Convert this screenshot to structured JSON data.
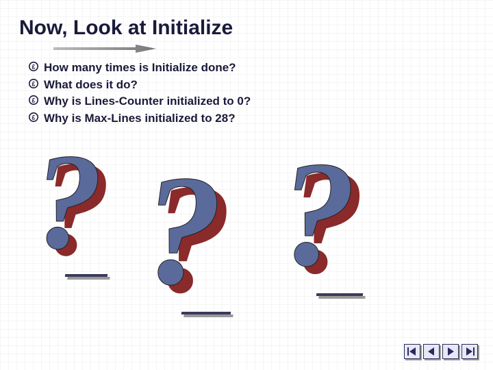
{
  "title": "Now, Look at Initialize",
  "bullets": [
    "How many times is Initialize done?",
    "What does it do?",
    "Why is Lines-Counter initialized to 0?",
    "Why is Max-Lines initialized to 28?"
  ],
  "qmark_glyph": "?",
  "colors": {
    "heading": "#1a1a3a",
    "bullet_text": "#1a1a3a",
    "qmark_fill": "#5a6a9a",
    "qmark_shadow": "#8a2a2a",
    "nav_border": "#2a2a60",
    "nav_bg": "#e8e8f4",
    "nav_arrow": "#2a2a60"
  },
  "nav": {
    "first": "first-slide",
    "prev": "previous-slide",
    "next": "next-slide",
    "last": "last-slide"
  }
}
